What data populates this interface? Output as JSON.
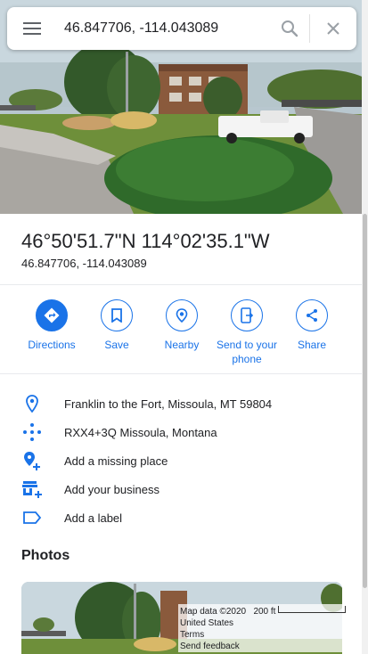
{
  "search": {
    "value": "46.847706, -114.043089"
  },
  "place": {
    "title": "46°50'51.7\"N 114°02'35.1\"W",
    "subtitle": "46.847706, -114.043089"
  },
  "actions": [
    {
      "label": "Directions",
      "icon": "directions-icon"
    },
    {
      "label": "Save",
      "icon": "bookmark-icon"
    },
    {
      "label": "Nearby",
      "icon": "nearby-icon"
    },
    {
      "label": "Send to your phone",
      "icon": "send-to-phone-icon"
    },
    {
      "label": "Share",
      "icon": "share-icon"
    }
  ],
  "info_rows": [
    {
      "text": "Franklin to the Fort, Missoula, MT 59804",
      "icon": "location-pin-icon"
    },
    {
      "text": "RXX4+3Q Missoula, Montana",
      "icon": "plus-code-icon"
    },
    {
      "text": "Add a missing place",
      "icon": "add-place-icon"
    },
    {
      "text": "Add your business",
      "icon": "add-business-icon"
    },
    {
      "text": "Add a label",
      "icon": "label-icon"
    }
  ],
  "photos": {
    "heading": "Photos"
  },
  "map_overlay": {
    "map_data": "Map data ©2020",
    "scale": "200 ft",
    "country": "United States",
    "terms": "Terms",
    "feedback": "Send feedback"
  },
  "colors": {
    "accent": "#1a73e8",
    "text": "#202124",
    "divider": "#e8eaed"
  }
}
